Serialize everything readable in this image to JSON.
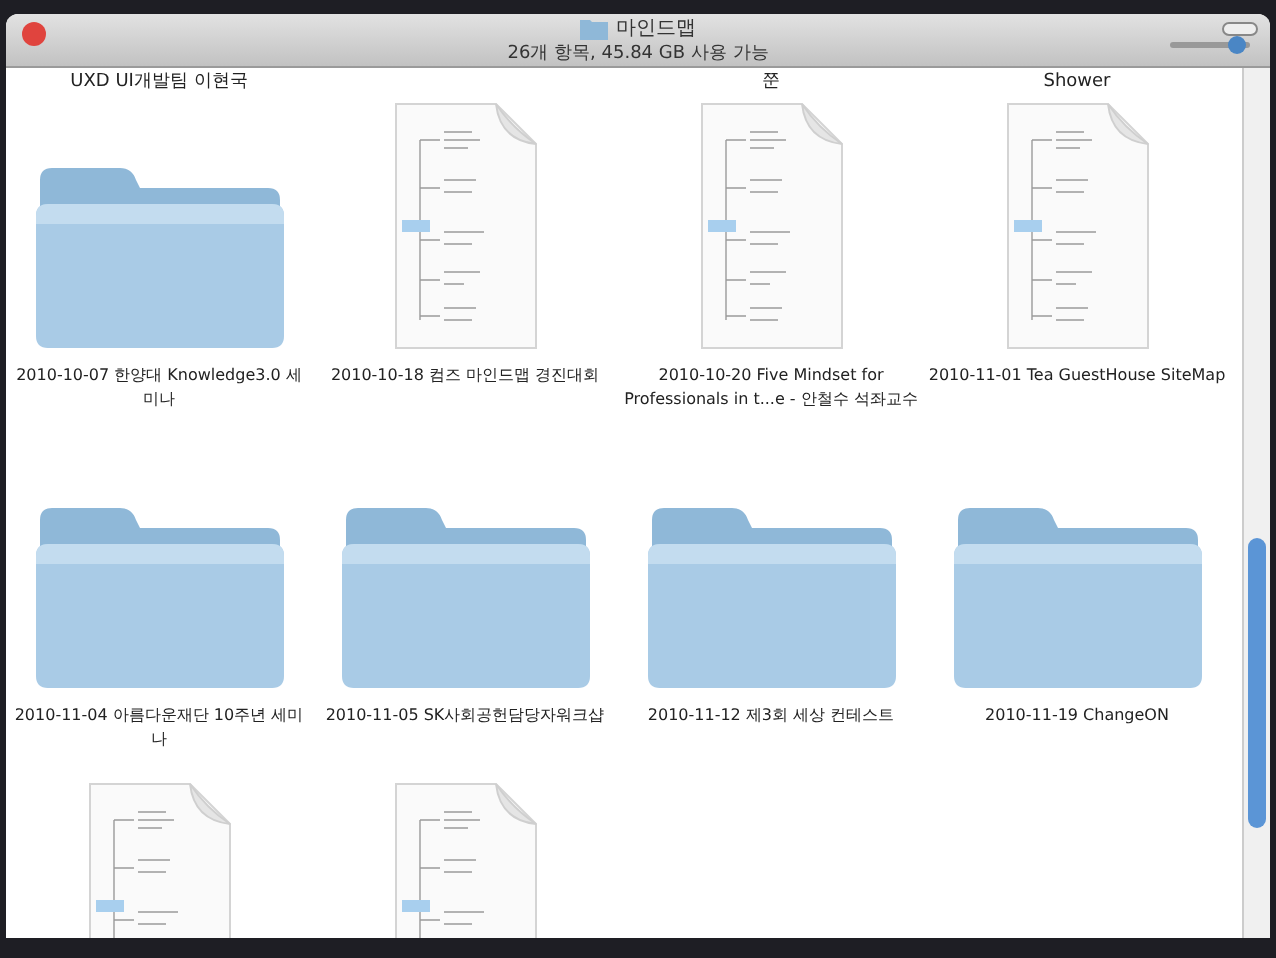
{
  "window": {
    "title": "마인드맵",
    "status": "26개 항목, 45.84 GB 사용 가능"
  },
  "icon_size_slider": {
    "level": 0.85
  },
  "cut_labels": [
    {
      "kind": "label",
      "label": "UXD UI개발팀 이현국"
    },
    {
      "kind": "blank"
    },
    {
      "kind": "label",
      "label": "쭌"
    },
    {
      "kind": "label",
      "label": "Shower"
    }
  ],
  "items": [
    {
      "kind": "folder",
      "label": "2010-10-07 한양대 Knowledge3.0 세미나"
    },
    {
      "kind": "document",
      "label": "2010-10-18 컴즈 마인드맵 경진대회"
    },
    {
      "kind": "document",
      "label": "2010-10-20 Five Mindset for Professionals in t...e - 안철수 석좌교수"
    },
    {
      "kind": "document",
      "label": "2010-11-01 Tea GuestHouse SiteMap"
    },
    {
      "kind": "folder",
      "label": "2010-11-04 아름다운재단 10주년 세미나"
    },
    {
      "kind": "folder",
      "label": "2010-11-05 SK사회공헌담당자워크샵"
    },
    {
      "kind": "folder",
      "label": "2010-11-12 제3회 세상 컨테스트"
    },
    {
      "kind": "folder",
      "label": "2010-11-19 ChangeON"
    },
    {
      "kind": "document"
    },
    {
      "kind": "document"
    }
  ]
}
